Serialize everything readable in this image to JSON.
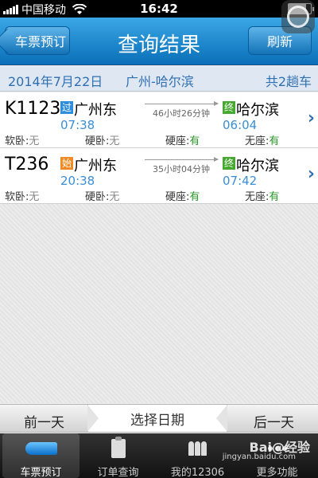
{
  "status_bar": {
    "carrier": "中国移动",
    "time": "16:42"
  },
  "nav": {
    "back_label": "车票预订",
    "title": "查询结果",
    "refresh_label": "刷新"
  },
  "summary": {
    "date": "2014年7月22日",
    "route": "广州-哈尔滨",
    "count": "共2趟车"
  },
  "trains": [
    {
      "number": "K1123",
      "from_badge": "过",
      "from_station": "广州东",
      "from_time": "07:38",
      "duration": "46小时26分钟",
      "to_badge": "终",
      "to_station": "哈尔滨",
      "to_time": "06:04",
      "seats": [
        {
          "label": "软卧:",
          "value": "无"
        },
        {
          "label": "硬卧:",
          "value": "无"
        },
        {
          "label": "硬座:",
          "value": "有"
        },
        {
          "label": "无座:",
          "value": "有"
        }
      ]
    },
    {
      "number": "T236",
      "from_badge": "始",
      "from_station": "广州东",
      "from_time": "20:38",
      "duration": "35小时04分钟",
      "to_badge": "终",
      "to_station": "哈尔滨",
      "to_time": "07:42",
      "seats": [
        {
          "label": "软卧:",
          "value": "无"
        },
        {
          "label": "硬卧:",
          "value": "无"
        },
        {
          "label": "硬座:",
          "value": "有"
        },
        {
          "label": "无座:",
          "value": "有"
        }
      ]
    }
  ],
  "date_bar": {
    "prev": "前一天",
    "pick": "选择日期",
    "next": "后一天"
  },
  "tabs": [
    {
      "label": "车票预订",
      "icon": "train-icon",
      "active": true
    },
    {
      "label": "订单查询",
      "icon": "clipboard-icon",
      "active": false
    },
    {
      "label": "我的12306",
      "icon": "people-icon",
      "active": false
    },
    {
      "label": "更多功能",
      "icon": "more-icon",
      "active": false
    }
  ],
  "watermark": {
    "text": "Bai@经验",
    "sub": "jingyan.baidu.com"
  },
  "colors": {
    "nav_blue": "#0a6fb8",
    "time_blue": "#3a8ed6",
    "available_green": "#2a9a2a",
    "none_gray": "#888888"
  }
}
